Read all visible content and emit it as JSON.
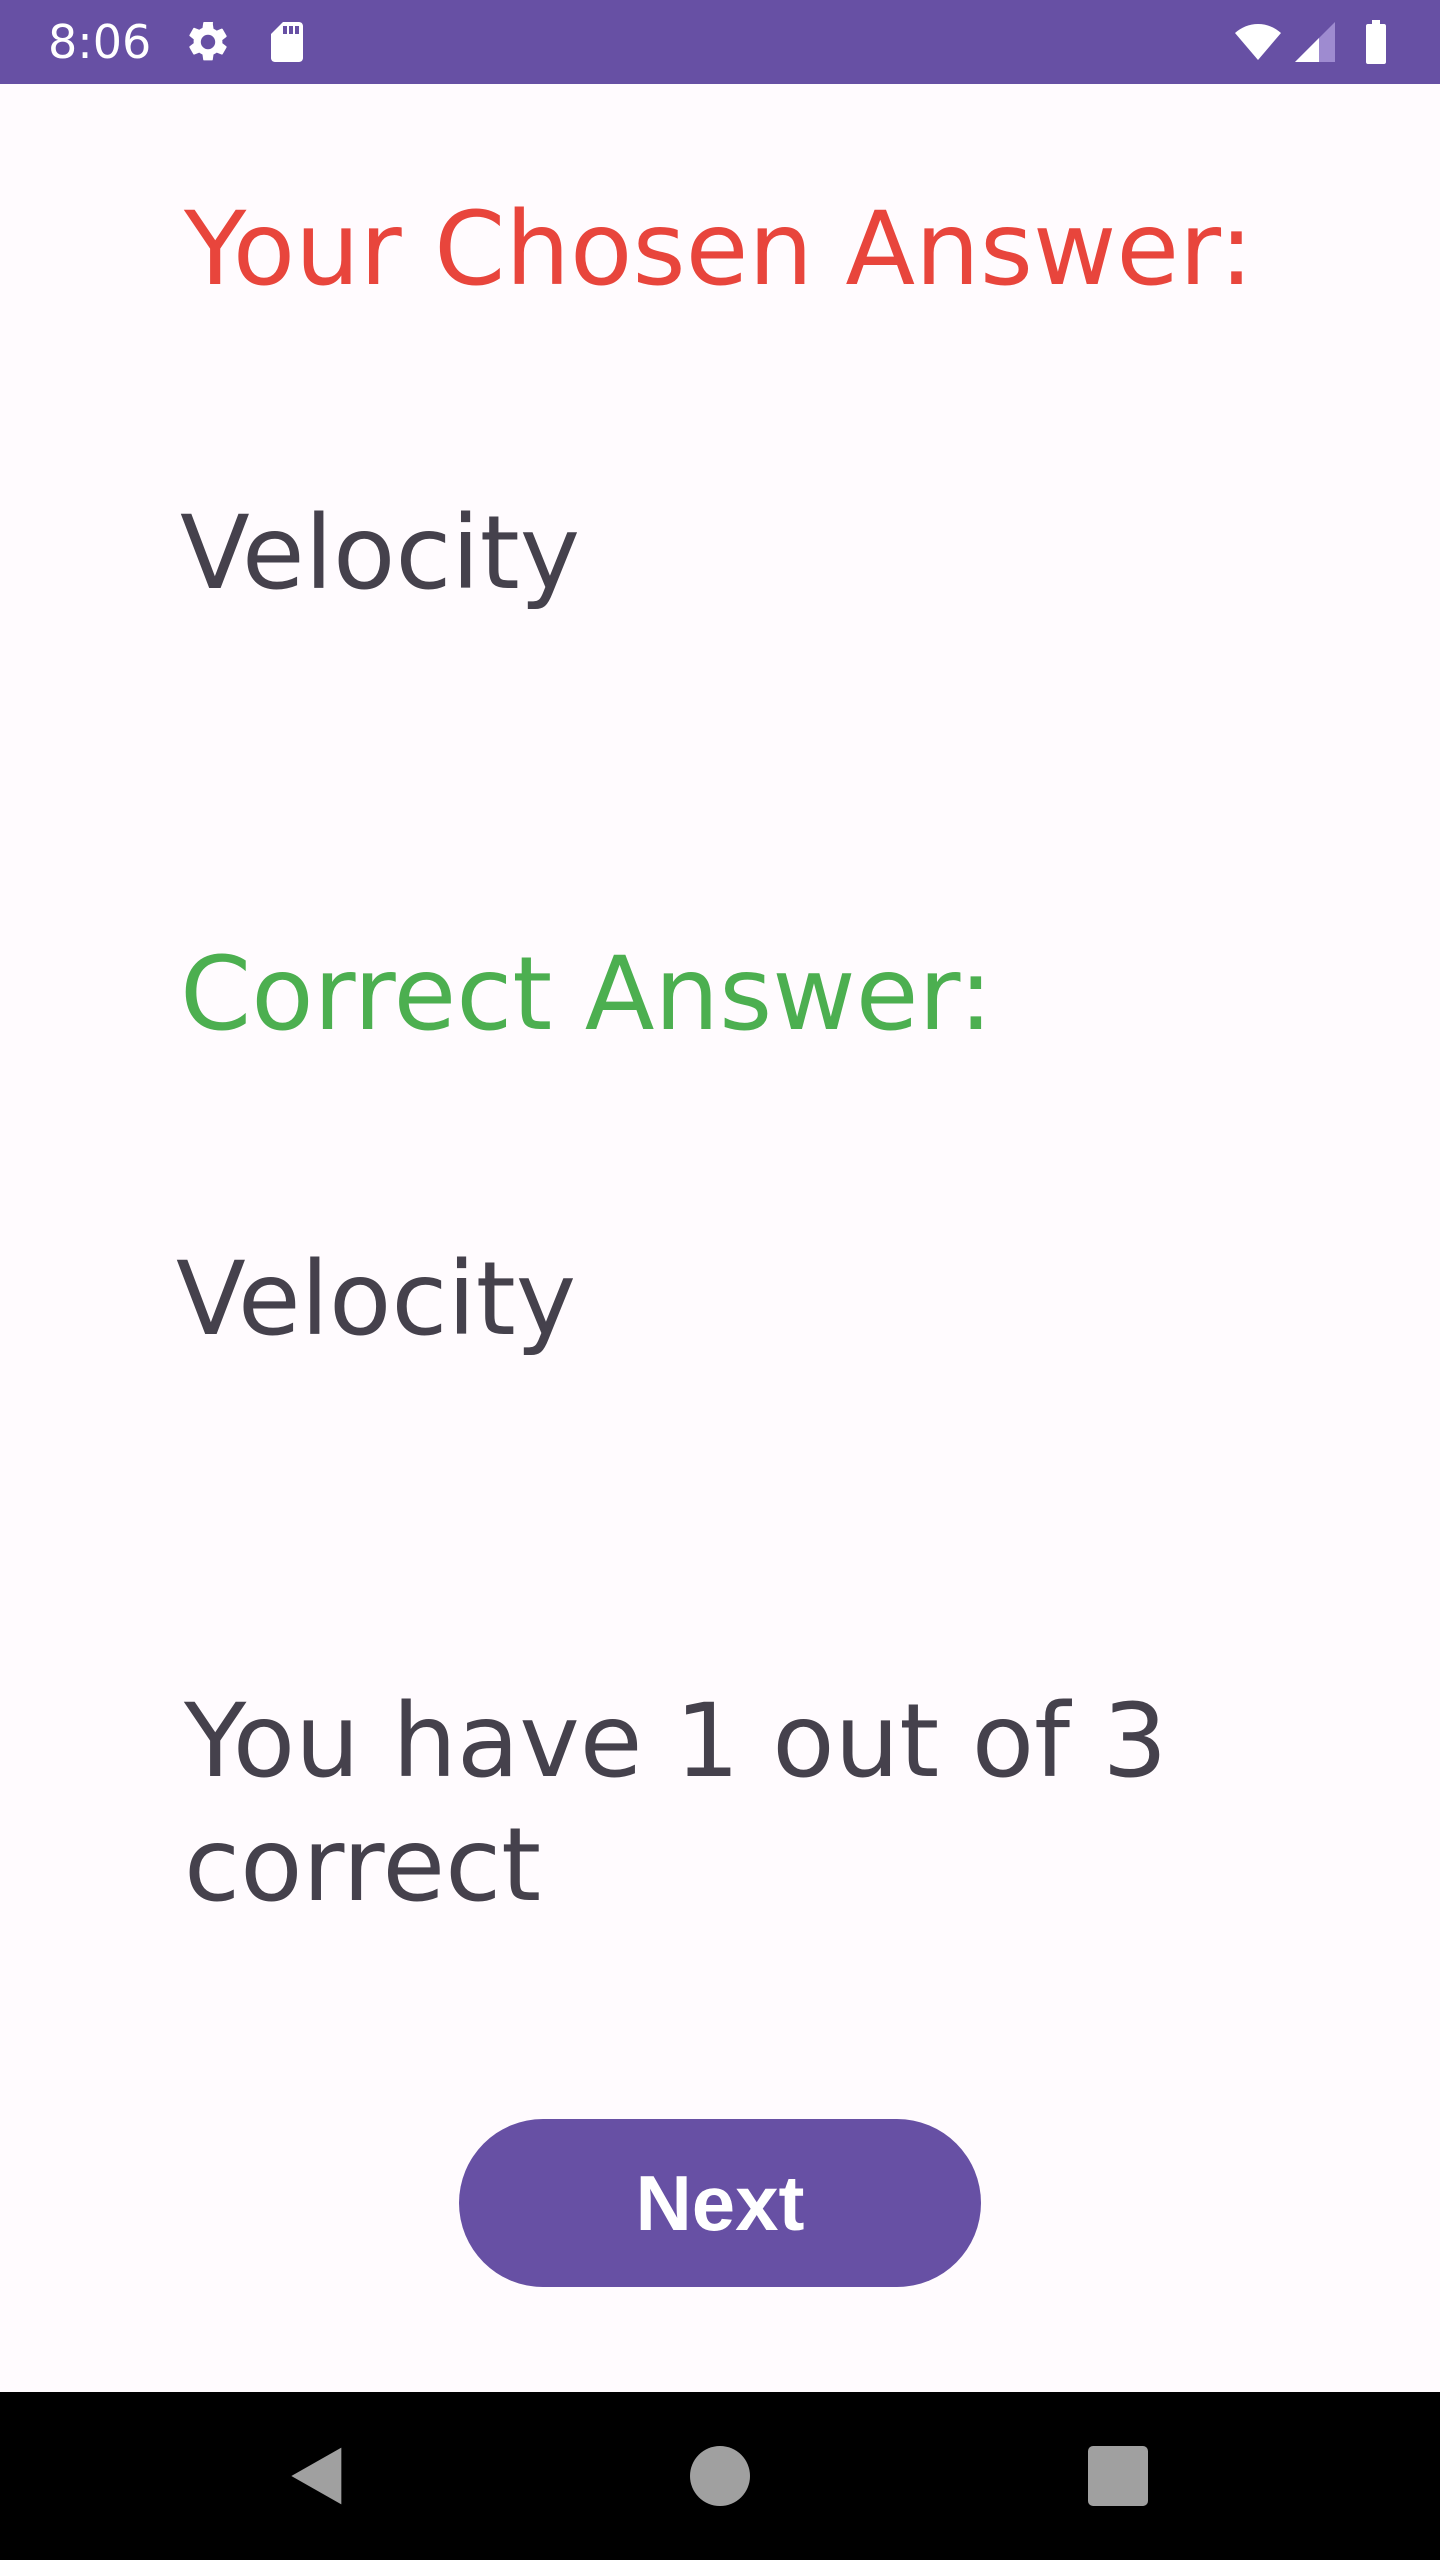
{
  "status_bar": {
    "time": "8:06",
    "icons": [
      "gear-icon",
      "sd-card-icon",
      "wifi-icon",
      "cell-signal-icon",
      "battery-icon"
    ],
    "background": "#6750A4"
  },
  "result": {
    "chosen_label": "Your Chosen Answer:",
    "chosen_value": "Velocity",
    "correct_label": "Correct Answer:",
    "correct_value": "Velocity",
    "score_text": "You have 1 out of 3 correct",
    "next_label": "Next"
  },
  "colors": {
    "chosen_label": "#E8453C",
    "correct_label": "#4CAF50",
    "body_text": "#45414C",
    "accent": "#6750A4"
  },
  "nav_bar": {
    "icons": [
      "back-icon",
      "home-icon",
      "recents-icon"
    ]
  }
}
